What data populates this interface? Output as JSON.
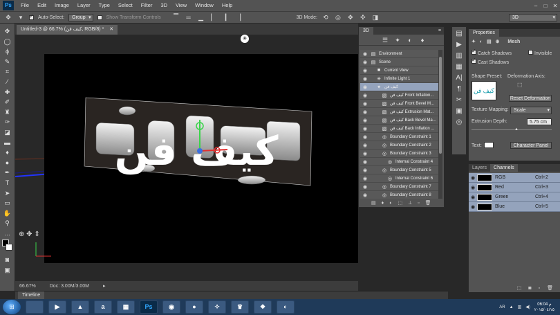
{
  "menubar": {
    "logo": "Ps",
    "items": [
      "File",
      "Edit",
      "Image",
      "Layer",
      "Type",
      "Select",
      "Filter",
      "3D",
      "View",
      "Window",
      "Help"
    ],
    "controls": [
      "–",
      "□",
      "✕"
    ]
  },
  "options": {
    "auto_select_label": "Auto-Select:",
    "auto_select_value": "Group",
    "transform_label": "Show Transform Controls",
    "mode_label": "3D Mode:",
    "workspace": "3D"
  },
  "document": {
    "tab_title": "Untitled-3 @ 66.7% (كيف فن, RGB/8) *",
    "zoom": "66.67%",
    "doc_size": "Doc: 3.00M/3.00M",
    "canvas_text": "كيف فن"
  },
  "timeline": {
    "label": "Timeline"
  },
  "panel3d": {
    "title": "3D",
    "items": [
      {
        "label": "Environment",
        "indent": 0,
        "icon": "environment-icon",
        "glyph": "▤"
      },
      {
        "label": "Scene",
        "indent": 0,
        "icon": "scene-icon",
        "glyph": "▤"
      },
      {
        "label": "Current View",
        "indent": 1,
        "icon": "camera-icon",
        "glyph": "■"
      },
      {
        "label": "Infinite Light 1",
        "indent": 1,
        "icon": "light-icon",
        "glyph": "✳"
      },
      {
        "label": "كيف فن",
        "indent": 1,
        "icon": "mesh-icon",
        "glyph": "✦",
        "selected": true
      },
      {
        "label": "كيف فن Front Inflation...",
        "indent": 2,
        "icon": "material-icon",
        "glyph": "▧"
      },
      {
        "label": "كيف فن Front Bevel M...",
        "indent": 2,
        "icon": "material-icon",
        "glyph": "▧"
      },
      {
        "label": "كيف فن Extrusion Mat...",
        "indent": 2,
        "icon": "material-icon",
        "glyph": "▧"
      },
      {
        "label": "كيف فن Back Bevel Ma...",
        "indent": 2,
        "icon": "material-icon",
        "glyph": "▧"
      },
      {
        "label": "كيف فن Back Inflation ...",
        "indent": 2,
        "icon": "material-icon",
        "glyph": "▧"
      },
      {
        "label": "Boundary Constraint 1",
        "indent": 2,
        "icon": "constraint-icon",
        "glyph": "◎"
      },
      {
        "label": "Boundary Constraint 2",
        "indent": 2,
        "icon": "constraint-icon",
        "glyph": "◎"
      },
      {
        "label": "Boundary Constraint 3",
        "indent": 2,
        "icon": "constraint-icon",
        "glyph": "◎"
      },
      {
        "label": "Internal Constraint 4",
        "indent": 3,
        "icon": "constraint-icon",
        "glyph": "◎"
      },
      {
        "label": "Boundary Constraint 5",
        "indent": 2,
        "icon": "constraint-icon",
        "glyph": "◎"
      },
      {
        "label": "Internal Constraint 6",
        "indent": 3,
        "icon": "constraint-icon",
        "glyph": "◎"
      },
      {
        "label": "Boundary Constraint 7",
        "indent": 2,
        "icon": "constraint-icon",
        "glyph": "◎"
      },
      {
        "label": "Boundary Constraint 8",
        "indent": 2,
        "icon": "constraint-icon",
        "glyph": "◎"
      }
    ]
  },
  "properties": {
    "tab": "Properties",
    "mode": "Mesh",
    "catch_shadows": "Catch Shadows",
    "cast_shadows": "Cast Shadows",
    "invisible": "Invisible",
    "shape_preset": "Shape Preset:",
    "deformation_axis": "Deformation Axis:",
    "reset_deformation": "Reset Deformation",
    "texture_mapping": "Texture Mapping:",
    "texture_value": "Scale",
    "extrusion_depth": "Extrusion Depth:",
    "extrusion_value": "5.75 cm",
    "text_label": "Text:",
    "character_panel": "Character Panel"
  },
  "channels": {
    "tabs": [
      "Layers",
      "Channels"
    ],
    "rows": [
      {
        "name": "RGB",
        "shortcut": "Ctrl+2"
      },
      {
        "name": "Red",
        "shortcut": "Ctrl+3"
      },
      {
        "name": "Green",
        "shortcut": "Ctrl+4"
      },
      {
        "name": "Blue",
        "shortcut": "Ctrl+5"
      }
    ]
  },
  "taskbar": {
    "apps": [
      "",
      "▶",
      "▲",
      "a",
      "▦",
      "Ps",
      "◉",
      "●",
      "✧",
      "♛",
      "❖",
      "◐"
    ],
    "lang": "AR",
    "time": "06:04 م",
    "date": "٢٠١٥/٠٤/١٥"
  }
}
